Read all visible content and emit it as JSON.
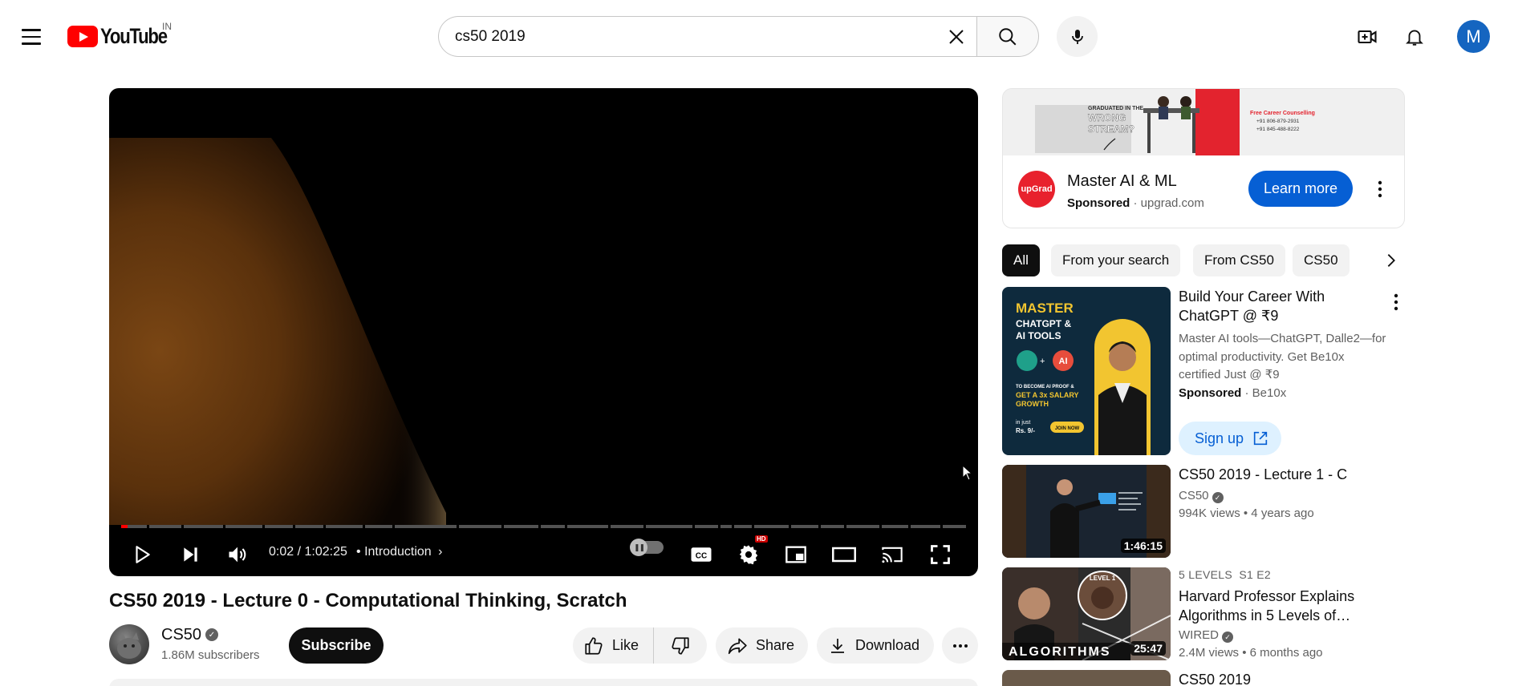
{
  "header": {
    "logo_text": "YouTube",
    "country_code": "IN",
    "search": {
      "value": "cs50 2019",
      "placeholder": "Search"
    },
    "avatar_letter": "M"
  },
  "player": {
    "time": "0:02 / 1:02:25",
    "chapter_separator": "•",
    "chapter": "Introduction",
    "hd_badge": "HD",
    "progress_fraction": 0.0005,
    "icons": [
      "play-icon",
      "next-icon",
      "volume-icon",
      "autoplay-toggle",
      "captions-icon",
      "settings-icon",
      "miniplayer-icon",
      "theater-icon",
      "cast-icon",
      "fullscreen-icon"
    ]
  },
  "video": {
    "title": "CS50 2019 - Lecture 0 - Computational Thinking, Scratch",
    "channel": "CS50",
    "subscribers": "1.86M subscribers",
    "subscribe_label": "Subscribe",
    "like_label": "Like",
    "share_label": "Share",
    "download_label": "Download"
  },
  "ad": {
    "banner_line1": "GRADUATED IN THE",
    "banner_line2": "WRONG",
    "banner_line3": "STREAM?",
    "banner_right1": "Free Career Counselling",
    "banner_right2": "+91 806-879-2931",
    "banner_right3": "+91 845-488-8222",
    "logo_text": "upGrad",
    "title": "Master AI & ML",
    "sponsored": "Sponsored",
    "domain": "· upgrad.com",
    "cta": "Learn more"
  },
  "chips": [
    "All",
    "From your search",
    "From CS50",
    "CS50"
  ],
  "recommendations": [
    {
      "title": "Build Your Career With ChatGPT @ ₹9",
      "description": "Master AI tools—ChatGPT, Dalle2—for optimal productivity. Get Be10x certified Just @ ₹9",
      "sponsored": "Sponsored",
      "advertiser": "· Be10x",
      "cta": "Sign up",
      "thumb_text": {
        "line1": "MASTER",
        "line2": "CHATGPT &",
        "line3": "AI TOOLS",
        "line4": "TO BECOME AI PROOF &",
        "line5": "GET A 3x SALARY",
        "line6": "GROWTH",
        "line7": "in just",
        "line8": "Rs. 9/-",
        "button": "JOIN NOW",
        "ai": "AI",
        "plus": "+"
      }
    },
    {
      "title": "CS50 2019 - Lecture 1 - C",
      "channel": "CS50",
      "views": "994K views",
      "age": "• 4 years ago",
      "duration": "1:46:15"
    },
    {
      "series": "5 LEVELS  S1 E2",
      "title": "Harvard Professor Explains Algorithms in 5 Levels of…",
      "channel": "WIRED",
      "views": "2.4M views",
      "age": "• 6 months ago",
      "duration": "25:47",
      "thumb_word": "ALGORITHMS",
      "thumb_badge": "LEVEL 1"
    },
    {
      "title": "CS50 2019"
    }
  ]
}
